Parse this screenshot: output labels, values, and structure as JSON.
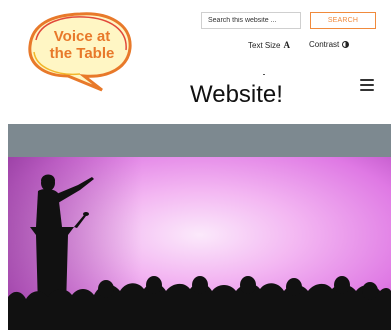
{
  "logo": {
    "text_line1": "Voice at",
    "text_line2": "the Table",
    "accent": "#e8792a"
  },
  "search": {
    "placeholder": "Search this website ...",
    "button_label": "SEARCH",
    "accent": "#f08a3c"
  },
  "accessibility": {
    "text_size_label": "Text Size",
    "text_size_glyph": "A",
    "contrast_label": "Contrast",
    "contrast_icon": "contrast-icon"
  },
  "header": {
    "title": "Website!",
    "menu_icon": "hamburger-menu-icon"
  },
  "colors": {
    "band": "#7d8990",
    "hero_pink": "#e27fe6",
    "hero_glow": "#fbe9fb",
    "silhouette": "#111111"
  }
}
